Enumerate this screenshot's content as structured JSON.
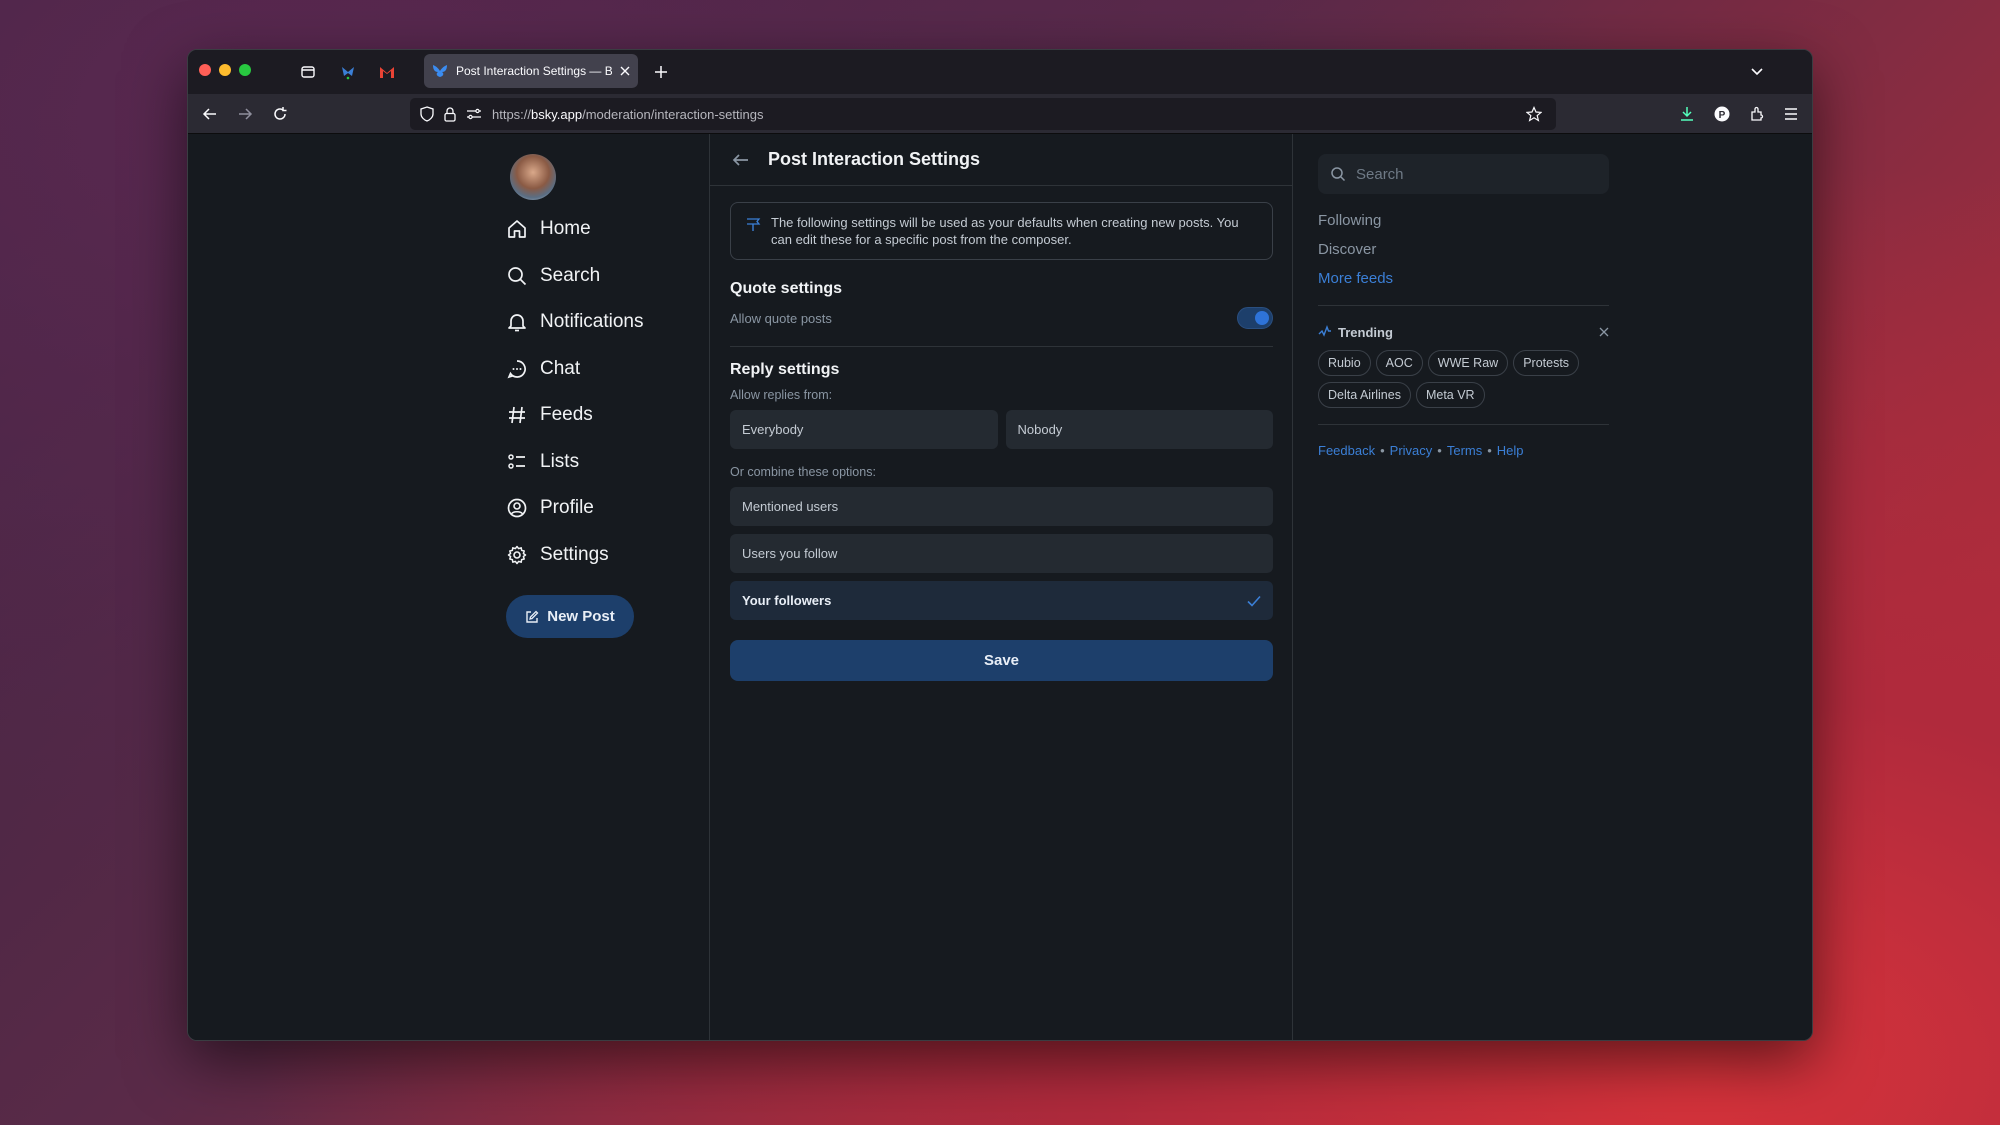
{
  "browser": {
    "tab_title": "Post Interaction Settings — Blue",
    "url_prefix": "https://",
    "url_domain": "bsky.app",
    "url_path": "/moderation/interaction-settings"
  },
  "nav": {
    "items": [
      {
        "label": "Home",
        "icon": "home-icon"
      },
      {
        "label": "Search",
        "icon": "search-icon"
      },
      {
        "label": "Notifications",
        "icon": "bell-icon"
      },
      {
        "label": "Chat",
        "icon": "chat-icon"
      },
      {
        "label": "Feeds",
        "icon": "hash-icon"
      },
      {
        "label": "Lists",
        "icon": "list-icon"
      },
      {
        "label": "Profile",
        "icon": "profile-icon"
      },
      {
        "label": "Settings",
        "icon": "gear-icon"
      }
    ],
    "new_post": "New Post"
  },
  "main": {
    "title": "Post Interaction Settings",
    "info": "The following settings will be used as your defaults when creating new posts. You can edit these for a specific post from the composer.",
    "quote_title": "Quote settings",
    "quote_label": "Allow quote posts",
    "quote_enabled": true,
    "reply_title": "Reply settings",
    "reply_label": "Allow replies from:",
    "everybody": "Everybody",
    "nobody": "Nobody",
    "combine_label": "Or combine these options:",
    "mentioned": "Mentioned users",
    "following": "Users you follow",
    "followers": "Your followers",
    "save": "Save"
  },
  "right": {
    "search_placeholder": "Search",
    "feeds": [
      "Following",
      "Discover",
      "More feeds"
    ],
    "trending_label": "Trending",
    "trending": [
      "Rubio",
      "AOC",
      "WWE Raw",
      "Protests",
      "Delta Airlines",
      "Meta VR"
    ],
    "footer": [
      "Feedback",
      "Privacy",
      "Terms",
      "Help"
    ]
  },
  "colors": {
    "accent": "#1d3f6b",
    "link": "#3b7fd6",
    "background": "#161a1f"
  }
}
